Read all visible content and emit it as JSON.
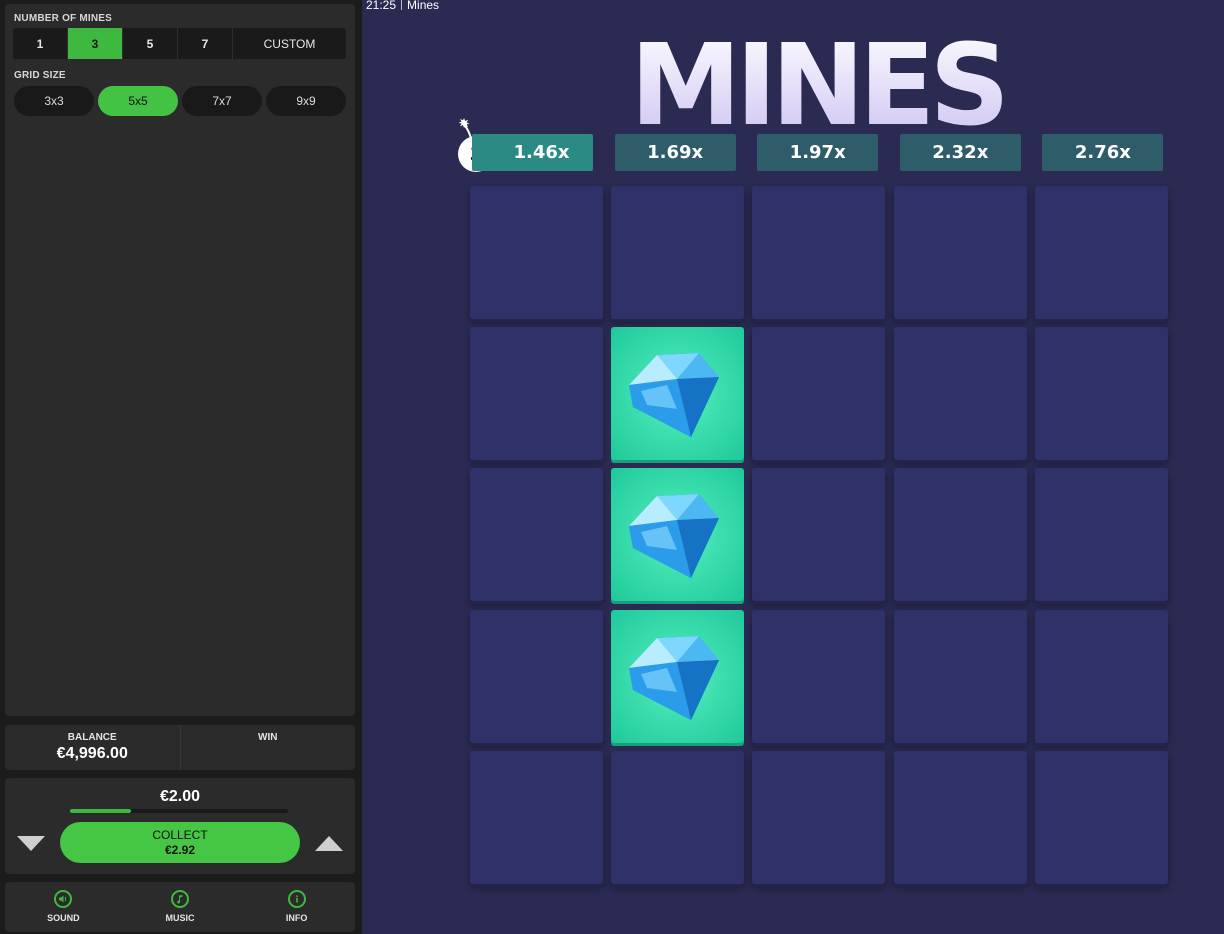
{
  "left_panel": {
    "mines_label": "NUMBER OF MINES",
    "mine_options": [
      "1",
      "3",
      "5",
      "7",
      "CUSTOM"
    ],
    "selected_mines": "3",
    "grid_label": "GRID SIZE",
    "grid_options": [
      "3x3",
      "5x5",
      "7x7",
      "9x9"
    ],
    "selected_grid": "5x5"
  },
  "balance": {
    "balance_label": "BALANCE",
    "balance_value": "€4,996.00",
    "win_label": "WIN"
  },
  "bet": {
    "amount": "€2.00",
    "slider_fraction": 0.28,
    "collect_label": "COLLECT",
    "collect_value": "€2.92"
  },
  "footer": {
    "items": [
      {
        "label": "SOUND",
        "icon": "speaker-icon"
      },
      {
        "label": "MUSIC",
        "icon": "music-note-icon"
      },
      {
        "label": "INFO",
        "icon": "info-icon"
      }
    ]
  },
  "game": {
    "time": "21:25",
    "window_title": "Mines",
    "logo_text": "MINES",
    "mines_count": "3",
    "multipliers": [
      "1.46x",
      "1.69x",
      "1.97x",
      "2.32x",
      "2.76x"
    ],
    "active_multiplier": 0,
    "board": {
      "cols": 5,
      "rows": 5,
      "revealed_gems": [
        [
          1,
          1
        ],
        [
          2,
          1
        ],
        [
          3,
          1
        ]
      ]
    }
  },
  "colors": {
    "accent_green": "#3fb83f",
    "game_bg": "#2b2a52",
    "tile": "#2f3268",
    "gem_tile": "#3fe0b0",
    "multiplier": "#2e5d69"
  }
}
